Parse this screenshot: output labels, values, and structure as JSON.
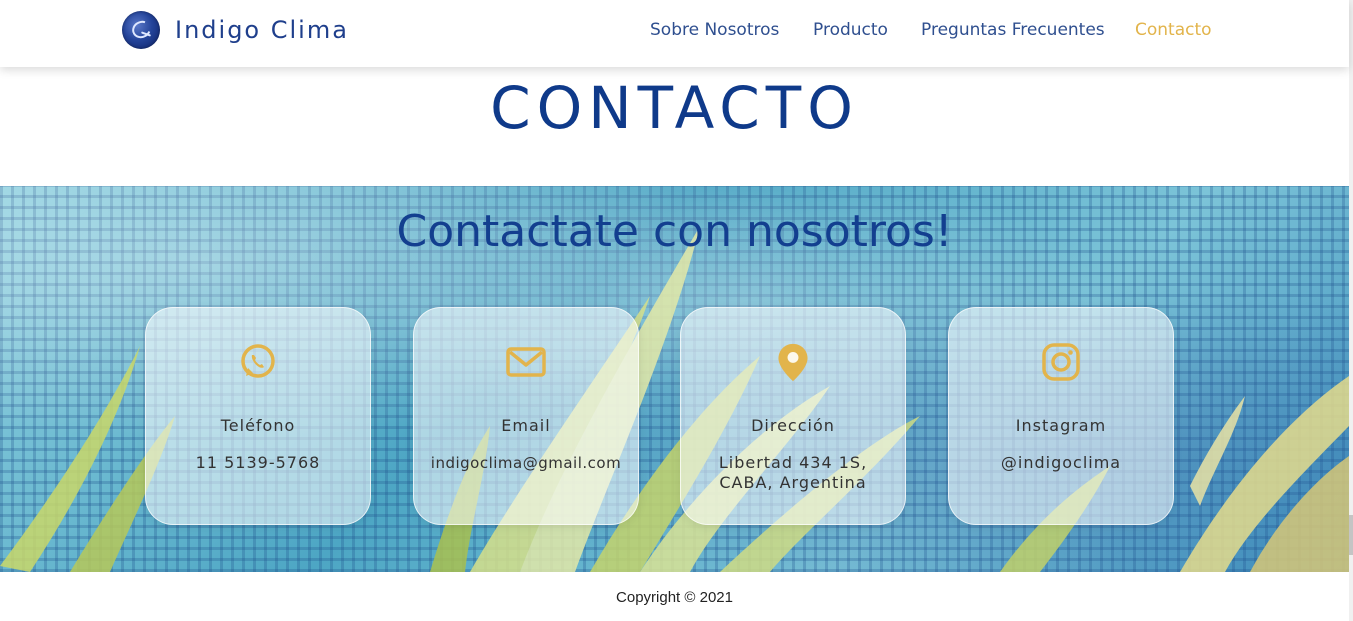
{
  "brand": {
    "name": "Indigo Clima",
    "logo_icon": "indigo-clima-logo"
  },
  "nav": {
    "items": [
      {
        "label": "Sobre Nosotros"
      },
      {
        "label": "Producto"
      },
      {
        "label": "Preguntas Frecuentes"
      },
      {
        "label": "Contacto",
        "active": true
      }
    ]
  },
  "page": {
    "title": "CONTACTO"
  },
  "hero": {
    "heading": "Contactate con nosotros!"
  },
  "cards": [
    {
      "icon": "whatsapp-icon",
      "label": "Teléfono",
      "value": "11 5139-5768"
    },
    {
      "icon": "envelope-icon",
      "label": "Email",
      "value": "indigoclima@gmail.com"
    },
    {
      "icon": "map-pin-icon",
      "label": "Dirección",
      "value": "Libertad 434 1S, CABA, Argentina"
    },
    {
      "icon": "instagram-icon",
      "label": "Instagram",
      "value": "@indigoclima"
    }
  ],
  "footer": {
    "copyright": "Copyright © 2021"
  },
  "colors": {
    "primary": "#0f3a8a",
    "accent": "#e2b44b",
    "nav_text": "#2f4f8f"
  }
}
